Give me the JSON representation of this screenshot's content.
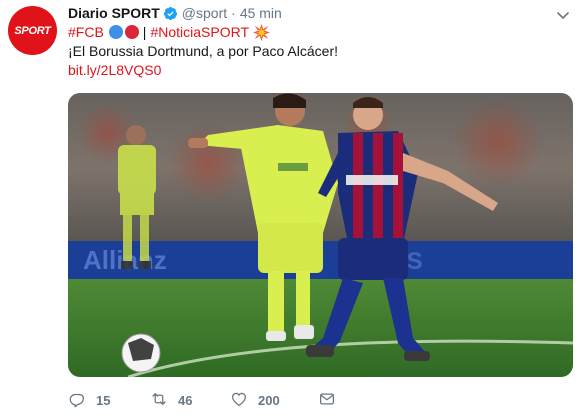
{
  "account": {
    "display_name": "Diario SPORT",
    "handle": "@sport",
    "separator": "·",
    "time": "45 min",
    "avatar_text": "SPORT"
  },
  "tweet": {
    "hashtag_1": "#FCB",
    "divider": "|",
    "hashtag_2": "#NoticiaSPORT",
    "text": "¡El Borussia Dortmund, a por Paco Alcácer!",
    "link": "bit.ly/2L8VQS0"
  },
  "media": {
    "description": "Football match photo: Barcelona player in blue-red kit and Getafe players in yellow-green kit chasing the ball",
    "board_text": "Allianz"
  },
  "actions": {
    "reply_count": "15",
    "retweet_count": "46",
    "like_count": "200"
  },
  "colors": {
    "accent": "#e1131a",
    "muted": "#657786",
    "verified": "#1da1f2"
  },
  "icons": [
    "verified-badge-icon",
    "caret-down-icon",
    "reply-icon",
    "retweet-icon",
    "like-icon",
    "dm-icon",
    "collision-icon"
  ]
}
